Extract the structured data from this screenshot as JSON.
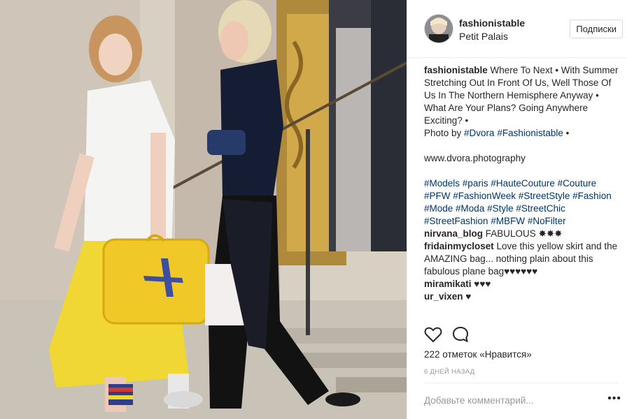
{
  "header": {
    "username": "fashionistable",
    "location": "Petit Palais",
    "follow_label": "Подписки"
  },
  "caption": {
    "username": "fashionistable",
    "text": " Where To Next • With Summer Stretching Out In Front Of Us, Well Those Of Us In The Northern Hemisphere Anyway • What Are Your Plans? Going Anywhere Exciting? •",
    "photo_by": "Photo by ",
    "tag_dvora": "#Dvora",
    "tag_fashionistable": "#Fashionistable",
    "bullet": " •",
    "website": "www.dvora.photography",
    "hashtags": [
      "#Models",
      "#paris",
      "#HauteCouture",
      "#Couture",
      "#PFW",
      "#FashionWeek",
      "#StreetStyle",
      "#Fashion",
      "#Mode",
      "#Moda",
      "#Style",
      "#StreetChic",
      "#StreetFashion",
      "#MBFW",
      "#NoFilter"
    ]
  },
  "comments": [
    {
      "user": "nirvana_blog",
      "text": " FABULOUS ✸✸✸"
    },
    {
      "user": "fridainmycloset",
      "text": " Love this yellow skirt and the AMAZING bag... nothing plain about this fabulous plane bag♥♥♥♥♥♥"
    },
    {
      "user": "miramikati",
      "text": " ♥♥♥"
    },
    {
      "user": "ur_vixen",
      "text": " ♥"
    }
  ],
  "icons": [
    "heart-icon",
    "comment-icon",
    "more-icon"
  ],
  "likes": "222 отметок «Нравится»",
  "time": "6 ДНЕЙ НАЗАД",
  "add_comment_placeholder": "Добавьте комментарий...",
  "more_label": "•••",
  "colors": {
    "link": "#003569",
    "muted": "#999999",
    "text": "#262626"
  }
}
